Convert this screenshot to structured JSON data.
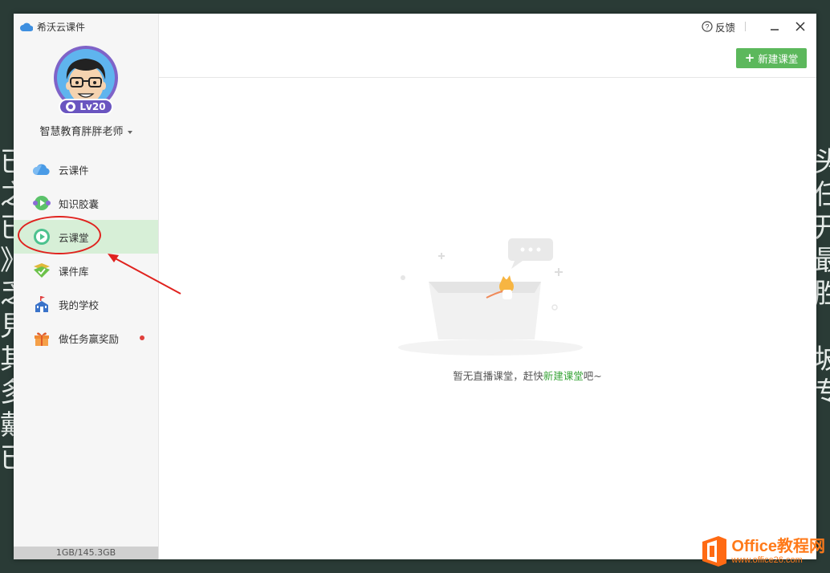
{
  "background": {
    "left_chars": [
      "已",
      "之",
      "已",
      "》",
      "乏",
      "見",
      "其",
      "多",
      "戴",
      "已"
    ],
    "right_chars": [
      "头",
      "任",
      "开",
      "最",
      "胜",
      "",
      "坡",
      "专",
      ""
    ]
  },
  "app": {
    "title": "希沃云课件",
    "level_badge": "Lv20",
    "username": "智慧教育胖胖老师",
    "storage": "1GB/145.3GB"
  },
  "nav": {
    "items": [
      {
        "label": "云课件",
        "icon": "cloud-icon"
      },
      {
        "label": "知识胶囊",
        "icon": "capsule-play-icon"
      },
      {
        "label": "云课堂",
        "icon": "play-circle-icon",
        "active": true
      },
      {
        "label": "课件库",
        "icon": "library-icon"
      },
      {
        "label": "我的学校",
        "icon": "school-icon"
      },
      {
        "label": "做任务赢奖励",
        "icon": "gift-icon",
        "notification_dot": true
      }
    ]
  },
  "toolbar": {
    "feedback_label": "反馈",
    "new_classroom_label": "新建课堂"
  },
  "empty_state": {
    "text_before": "暂无直播课堂，赶快",
    "link_text": "新建课堂",
    "text_after": "吧~"
  },
  "watermark": {
    "brand": "Office教程网",
    "url": "www.office26.com"
  },
  "colors": {
    "accent_green": "#5cb85c",
    "active_nav_bg": "#d7efd7",
    "annotation_red": "#e0221e",
    "level_purple": "#6a55c0"
  }
}
